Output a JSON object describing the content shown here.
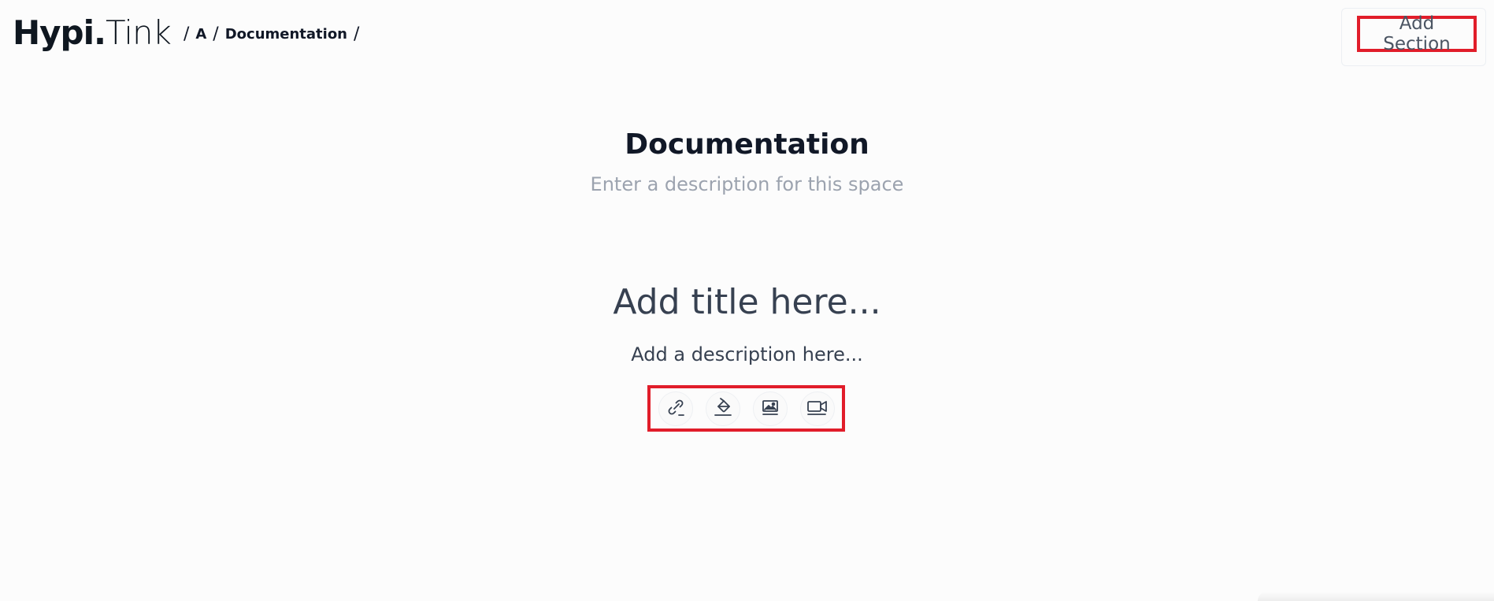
{
  "brand": {
    "logo_bold": "Hypi.",
    "logo_light": "Tink"
  },
  "breadcrumb": {
    "separator": "/",
    "items": [
      "A",
      "Documentation"
    ]
  },
  "header": {
    "add_section_label": "Add Section"
  },
  "space": {
    "title": "Documentation",
    "description_placeholder": "Enter a description for this space"
  },
  "section": {
    "title_placeholder": "Add title here...",
    "description_placeholder": "Add a description here..."
  },
  "toolbar": {
    "tools": [
      {
        "name": "link-icon"
      },
      {
        "name": "fill-icon"
      },
      {
        "name": "image-icon"
      },
      {
        "name": "video-icon"
      }
    ]
  },
  "colors": {
    "highlight_border": "#e11d2a",
    "background": "#fcfcfc",
    "text_primary": "#111827",
    "text_muted": "#9ca3af"
  }
}
